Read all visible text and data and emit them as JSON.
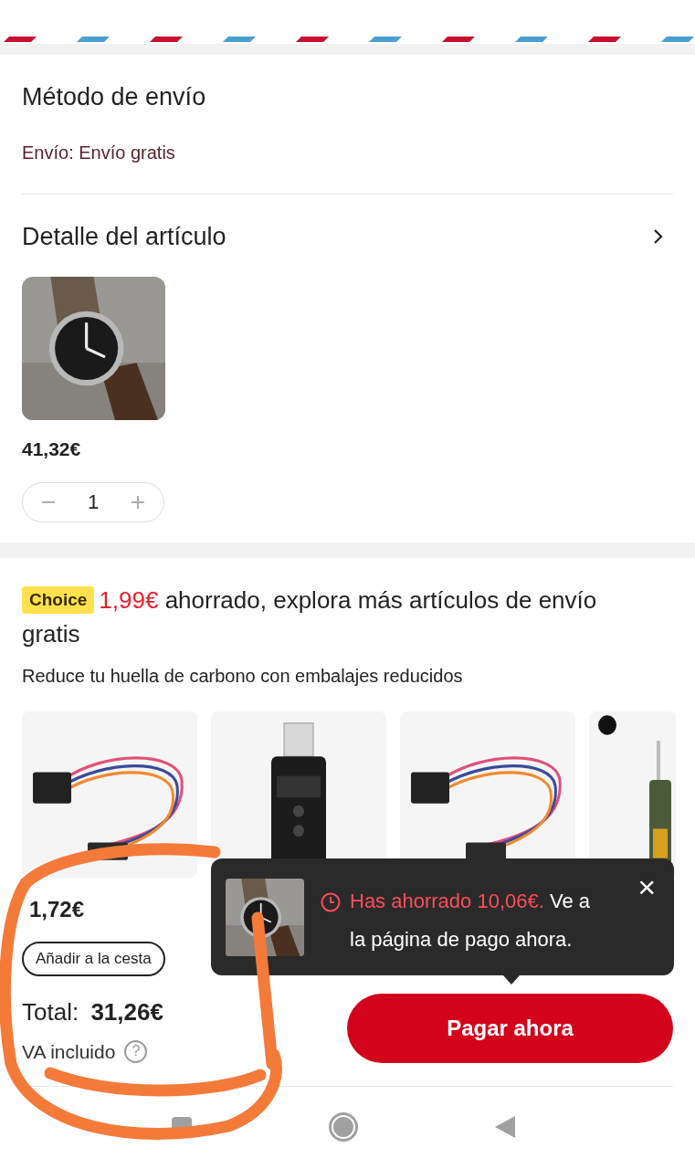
{
  "shipping": {
    "title": "Método de envío",
    "value": "Envío: Envío gratis"
  },
  "item_detail": {
    "title": "Detalle del artículo",
    "price": "41,32€",
    "quantity": {
      "minus": "−",
      "value": "1",
      "plus": "+"
    }
  },
  "promo": {
    "badge": "Choice",
    "saved": "1,99€",
    "headline": "ahorrado, explora más artículos de envío gratis",
    "subtitle": "Reduce tu huella de carbono con embalajes reducidos"
  },
  "products": [
    {
      "kind": "cable",
      "price": "1,72€",
      "button": "Añadir a la cesta"
    },
    {
      "kind": "usb"
    },
    {
      "kind": "cable"
    },
    {
      "kind": "module"
    }
  ],
  "toast": {
    "highlight": "Has ahorrado 10,06€.",
    "rest": "Ve a la página de pago ahora.",
    "close": "×"
  },
  "footer": {
    "total_label": "Total:",
    "total": "31,26€",
    "tax": "VA incluido",
    "help": "?",
    "pay_button": "Pagar ahora"
  }
}
